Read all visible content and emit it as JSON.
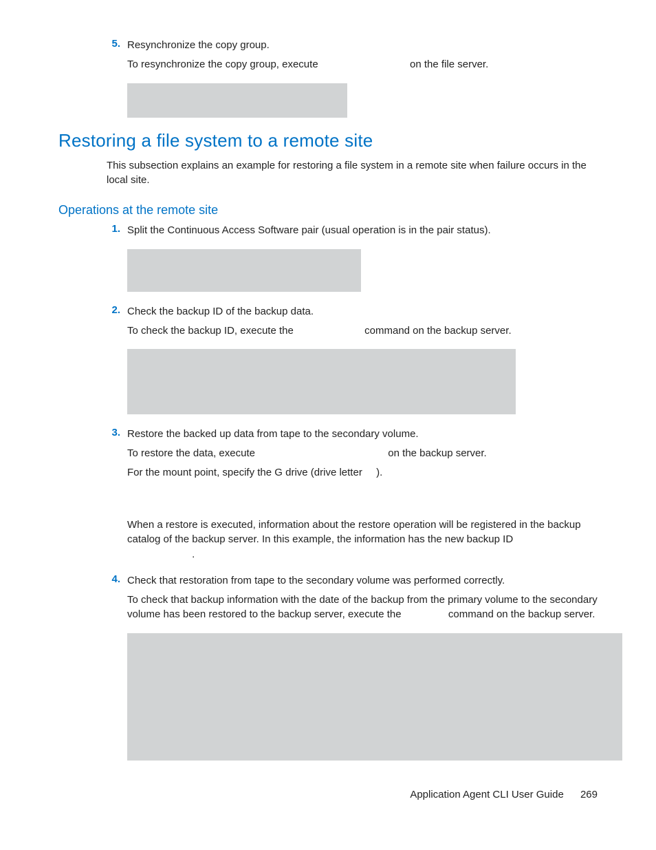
{
  "top": {
    "num": "5.",
    "line1": "Resynchronize the copy group.",
    "line2a": "To resynchronize the copy group, execute",
    "line2b": "on the file server."
  },
  "h2": "Restoring a file system to a remote site",
  "intro": "This subsection explains an example for restoring a file system in a remote site when failure occurs in the local site.",
  "h3": "Operations at the remote site",
  "steps": {
    "s1": {
      "num": "1.",
      "l1": "Split the Continuous Access Software pair (usual operation is in the pair status)."
    },
    "s2": {
      "num": "2.",
      "l1": "Check the backup ID of the backup data.",
      "l2a": "To check the backup ID, execute the",
      "l2b": "command on the backup server."
    },
    "s3": {
      "num": "3.",
      "l1": "Restore the backed up data from tape to the secondary volume.",
      "l2a": "To restore the data, execute",
      "l2b": "on the backup server.",
      "l3a": "For the mount point, specify the G drive (drive letter",
      "l3b": ").",
      "l4": "When a restore is executed, information about the restore operation will be registered in the backup catalog of the backup server. In this example, the information has the new backup ID",
      "l4end": "."
    },
    "s4": {
      "num": "4.",
      "l1": "Check that restoration from tape to the secondary volume was performed correctly.",
      "l2a": "To check that backup information with the date of the backup from the primary volume to the secondary volume has been restored to the backup server, execute the",
      "l2b": "command on the backup server."
    }
  },
  "footer": {
    "title": "Application Agent CLI User Guide",
    "page": "269"
  }
}
